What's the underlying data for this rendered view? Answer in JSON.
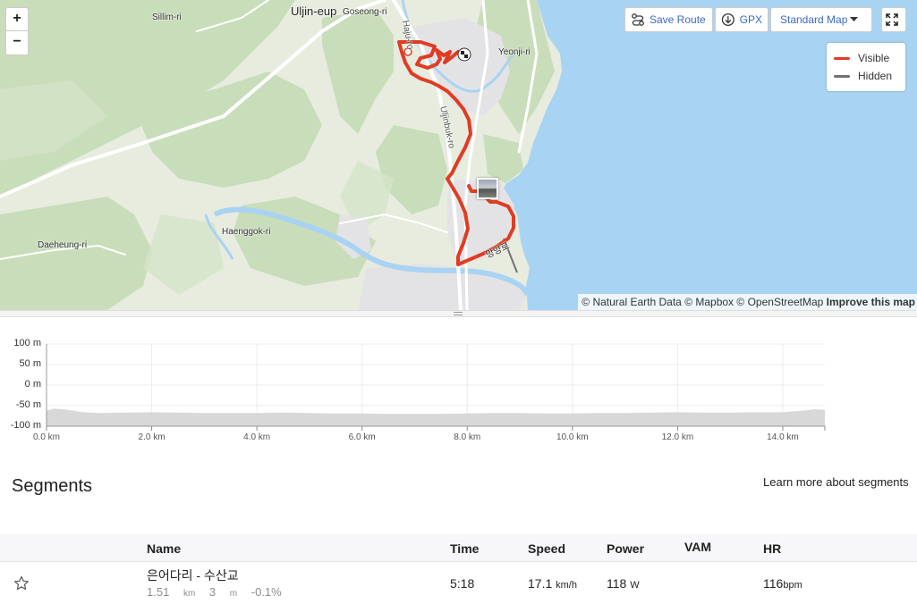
{
  "map": {
    "labels": {
      "uljin_eup": "Uljin-eup",
      "goseong_ri": "Goseong-ri",
      "sillim_ri": "Sillim-ri",
      "yeonji_ri": "Yeonji-ri",
      "haenggok_ri": "Haenggok-ri",
      "daeheung_ri": "Daeheung-ri",
      "uljinbuk_ro": "Uljinbuk-ro",
      "haju_ro": "Haju-ro",
      "korean_road": "망양로"
    },
    "zoom_in": "+",
    "zoom_out": "−",
    "save_route": "Save Route",
    "gpx": "GPX",
    "map_style": "Standard Map",
    "legend": {
      "visible": "Visible",
      "hidden": "Hidden",
      "visible_color": "#e03c23",
      "hidden_color": "#707075"
    },
    "attribution": {
      "natural_earth": "© Natural Earth Data",
      "mapbox": "© Mapbox",
      "osm": "© OpenStreetMap",
      "improve": "Improve this map"
    }
  },
  "elevation": {
    "y_ticks": [
      "100 m",
      "50 m",
      "0 m",
      "-50 m",
      "-100 m"
    ],
    "x_ticks": [
      "0.0 km",
      "2.0 km",
      "4.0 km",
      "6.0 km",
      "8.0 km",
      "10.0 km",
      "12.0 km",
      "14.0 km"
    ],
    "y_range": [
      -100,
      100
    ],
    "x_range_km": [
      0,
      14.8
    ],
    "profile_m": [
      [
        0,
        -62
      ],
      [
        0.15,
        -57
      ],
      [
        0.4,
        -60
      ],
      [
        0.7,
        -66
      ],
      [
        1.0,
        -68
      ],
      [
        1.5,
        -67
      ],
      [
        2.0,
        -66
      ],
      [
        2.5,
        -67
      ],
      [
        3.0,
        -68
      ],
      [
        3.5,
        -68
      ],
      [
        4.0,
        -68
      ],
      [
        4.5,
        -67
      ],
      [
        5.0,
        -68
      ],
      [
        5.5,
        -69
      ],
      [
        6.0,
        -69
      ],
      [
        6.5,
        -70
      ],
      [
        7.0,
        -70
      ],
      [
        7.5,
        -70
      ],
      [
        8.0,
        -69
      ],
      [
        8.5,
        -68
      ],
      [
        9.0,
        -68
      ],
      [
        9.5,
        -69
      ],
      [
        10.0,
        -69
      ],
      [
        10.5,
        -68
      ],
      [
        11.0,
        -68
      ],
      [
        11.5,
        -67
      ],
      [
        12.0,
        -66
      ],
      [
        12.5,
        -67
      ],
      [
        13.0,
        -67
      ],
      [
        13.5,
        -66
      ],
      [
        14.0,
        -66
      ],
      [
        14.4,
        -62
      ],
      [
        14.6,
        -59
      ],
      [
        14.8,
        -60
      ]
    ]
  },
  "segments": {
    "title": "Segments",
    "learn_more": "Learn more about segments",
    "headers": {
      "name": "Name",
      "time": "Time",
      "speed": "Speed",
      "power": "Power",
      "vam": "VAM",
      "hr": "HR"
    },
    "rows": [
      {
        "name": "은어다리 - 수산교",
        "distance": "1.51",
        "distance_unit": "km",
        "elev": "3",
        "elev_unit": "m",
        "grade": "-0.1%",
        "time": "5:18",
        "speed": "17.1",
        "speed_unit": "km/h",
        "power": "118",
        "power_unit": "W",
        "vam": "",
        "hr": "116",
        "hr_unit": "bpm"
      }
    ]
  }
}
